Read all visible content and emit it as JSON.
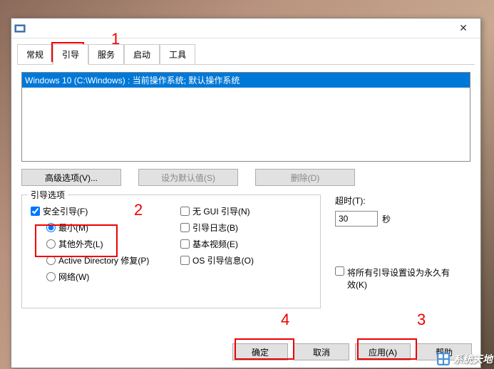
{
  "titlebar": {
    "close": "✕"
  },
  "tabs": {
    "general": "常规",
    "boot": "引导",
    "services": "服务",
    "startup": "启动",
    "tools": "工具"
  },
  "list": {
    "item0": "Windows 10 (C:\\Windows) : 当前操作系统; 默认操作系统"
  },
  "buttons": {
    "advanced": "高级选项(V)...",
    "set_default": "设为默认值(S)",
    "delete": "删除(D)"
  },
  "boot_options": {
    "title": "引导选项",
    "safe_boot": "安全引导(F)",
    "minimal": "最小(M)",
    "alt_shell": "其他外壳(L)",
    "ad_repair": "Active Directory 修复(P)",
    "network": "网络(W)",
    "no_gui": "无 GUI 引导(N)",
    "boot_log": "引导日志(B)",
    "base_video": "基本视频(E)",
    "os_boot_info": "OS 引导信息(O)"
  },
  "timeout": {
    "label": "超时(T):",
    "value": "30",
    "unit": "秒"
  },
  "permanent": {
    "label": "将所有引导设置设为永久有效(K)"
  },
  "dialog_buttons": {
    "ok": "确定",
    "cancel": "取消",
    "apply": "应用(A)",
    "help": "帮助"
  },
  "annotations": {
    "n1": "1",
    "n2": "2",
    "n3": "3",
    "n4": "4"
  },
  "watermark": {
    "text": "系统天地"
  }
}
